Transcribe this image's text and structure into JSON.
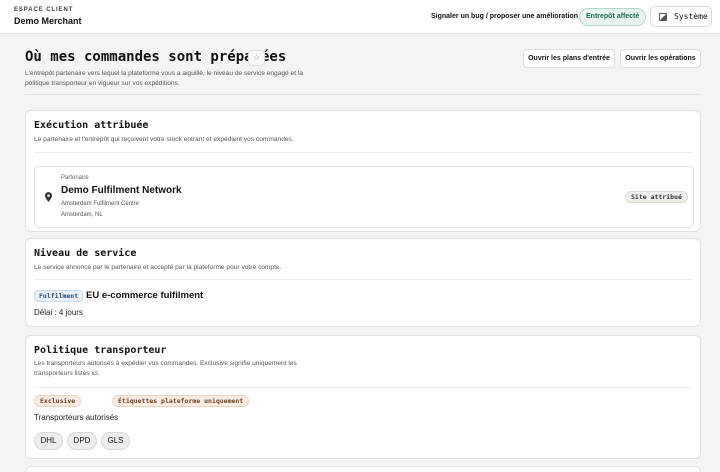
{
  "header": {
    "brand_sub": "ESPACE CLIENT",
    "brand_name": "Demo Merchant",
    "bug_link": "Signaler un bug / proposer une amélioration",
    "warehouse_status": "Entrepôt affecté",
    "theme_label": "Système",
    "theme_icon": "contrast-icon"
  },
  "page": {
    "title": "Où mes commandes sont préparées",
    "star_icon": "star-icon",
    "description": "L'entrepôt partenaire vers lequel la plateforme vous a aiguillé, le niveau de service engagé et la politique transporteur en vigueur sur vos expéditions.",
    "buttons": {
      "inbound_plans": "Ouvrir les plans d'entrée",
      "operations": "Ouvrir les opérations"
    }
  },
  "execution": {
    "title": "Exécution attribuée",
    "description": "Le partenaire et l'entrepôt qui reçoivent votre stock entrant et expédient vos commandes.",
    "partner_label": "Partenaire",
    "partner_name": "Demo Fulfilment Network",
    "site_name": "Amsterdam Fulfilment Centre",
    "site_location": "Amsterdam, NL",
    "site_badge": "Site attribué",
    "pin_icon": "map-pin-icon"
  },
  "service": {
    "title": "Niveau de service",
    "description": "Le service annoncé par le partenaire et accepté par la plateforme pour votre compte.",
    "badge": "Fulfilment",
    "name": "EU e-commerce fulfilment",
    "delay_label": "Délai :",
    "delay_value": "4 jours"
  },
  "carrier_policy": {
    "title": "Politique transporteur",
    "description": "Les transporteurs autorisés à expédier vos commandes. Exclusive signifie uniquement les transporteurs listés ici.",
    "badges": [
      "Exclusive",
      "Étiquettes plateforme uniquement"
    ],
    "carriers_label": "Transporteurs autorisés",
    "carriers": [
      "DHL",
      "DPD",
      "GLS"
    ]
  },
  "colors": {
    "accent_green": "#1d6a50",
    "badge_blue": "#244a72",
    "badge_orange": "#6e3d1c"
  }
}
